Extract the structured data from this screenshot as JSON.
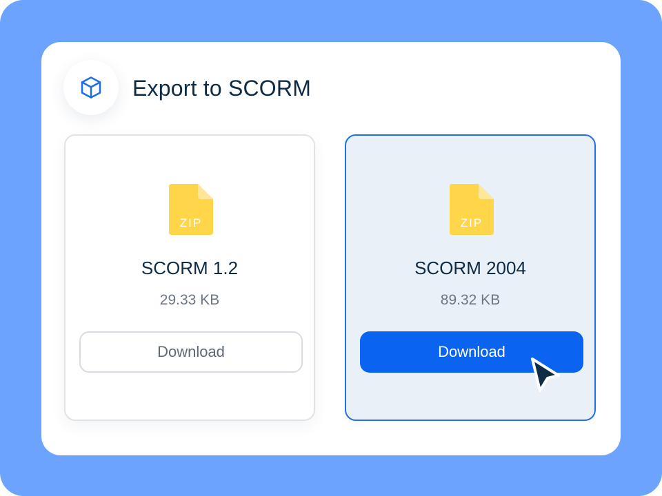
{
  "dialog": {
    "title": "Export to SCORM",
    "icon": "package-cube-icon"
  },
  "options": [
    {
      "file_type": "ZIP",
      "name": "SCORM 1.2",
      "size": "29.33 KB",
      "download_label": "Download",
      "selected": false
    },
    {
      "file_type": "ZIP",
      "name": "SCORM 2004",
      "size": "89.32 KB",
      "download_label": "Download",
      "selected": true
    }
  ],
  "colors": {
    "background": "#6ba3ff",
    "panel": "#ffffff",
    "primary": "#0a64f0",
    "selected_card_bg": "#eaf0f8",
    "selected_card_border": "#1f6fe8",
    "zip_icon": "#ffd54a",
    "title_text": "#0d2b45"
  }
}
